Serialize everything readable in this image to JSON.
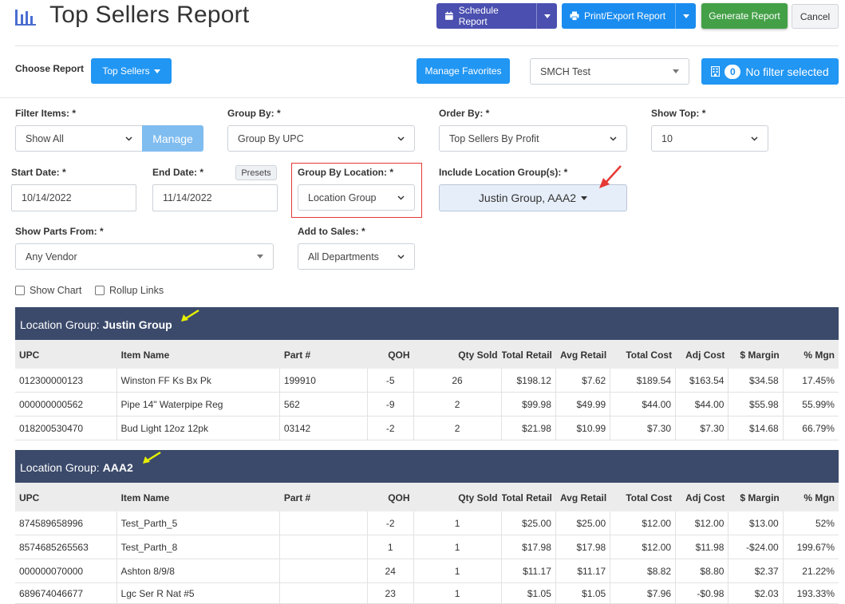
{
  "header": {
    "title": "Top Sellers Report",
    "schedule_label": "Schedule Report",
    "print_label": "Print/Export Report",
    "generate_label": "Generate Report",
    "cancel_label": "Cancel"
  },
  "toolbar": {
    "choose_report_label": "Choose Report",
    "report_type": "Top Sellers",
    "manage_favorites_label": "Manage Favorites",
    "store_value": "SMCH Test",
    "filter_count": "0",
    "filter_label": "No filter selected"
  },
  "filters": {
    "filter_items_label": "Filter Items: *",
    "filter_items_value": "Show All",
    "manage_label": "Manage",
    "group_by_label": "Group By: *",
    "group_by_value": "Group By UPC",
    "order_by_label": "Order By: *",
    "order_by_value": "Top Sellers By Profit",
    "show_top_label": "Show Top: *",
    "show_top_value": "10",
    "start_date_label": "Start Date: *",
    "start_date_value": "10/14/2022",
    "end_date_label": "End Date: *",
    "end_date_value": "11/14/2022",
    "presets_label": "Presets",
    "group_by_location_label": "Group By Location: *",
    "group_by_location_value": "Location Group",
    "include_groups_label": "Include Location Group(s): *",
    "include_groups_value": "Justin Group, AAA2",
    "show_parts_label": "Show Parts From: *",
    "show_parts_value": "Any Vendor",
    "add_to_sales_label": "Add to Sales: *",
    "add_to_sales_value": "All Departments",
    "show_chart_label": "Show Chart",
    "rollup_links_label": "Rollup Links"
  },
  "table": {
    "columns": [
      "UPC",
      "Item Name",
      "Part #",
      "QOH",
      "Qty Sold",
      "Total Retail",
      "Avg Retail",
      "Total Cost",
      "Adj Cost",
      "$ Margin",
      "% Mgn"
    ],
    "groups": [
      {
        "prefix": "Location Group:",
        "name": "Justin Group",
        "rows": [
          [
            "012300000123",
            "Winston FF Ks Bx Pk",
            "199910",
            "-5",
            "26",
            "$198.12",
            "$7.62",
            "$189.54",
            "$163.54",
            "$34.58",
            "17.45%"
          ],
          [
            "000000000562",
            "Pipe 14\" Waterpipe Reg",
            "562",
            "-9",
            "2",
            "$99.98",
            "$49.99",
            "$44.00",
            "$44.00",
            "$55.98",
            "55.99%"
          ],
          [
            "018200530470",
            "Bud Light 12oz 12pk",
            "03142",
            "-2",
            "2",
            "$21.98",
            "$10.99",
            "$7.30",
            "$7.30",
            "$14.68",
            "66.79%"
          ]
        ]
      },
      {
        "prefix": "Location Group:",
        "name": "AAA2",
        "rows": [
          [
            "874589658996",
            "Test_Parth_5",
            "",
            "-2",
            "1",
            "$25.00",
            "$25.00",
            "$12.00",
            "$12.00",
            "$13.00",
            "52%"
          ],
          [
            "8574685265563",
            "Test_Parth_8",
            "",
            "1",
            "1",
            "$17.98",
            "$17.98",
            "$12.00",
            "$11.98",
            "-$24.00",
            "199.67%"
          ],
          [
            "000000070000",
            "Ashton 8/9/8",
            "",
            "24",
            "1",
            "$11.17",
            "$11.17",
            "$8.82",
            "$8.80",
            "$2.37",
            "21.22%"
          ],
          [
            "689674046677",
            "Lgc Ser R Nat #5",
            "",
            "23",
            "1",
            "$1.05",
            "$1.05",
            "$7.96",
            "-$0.98",
            "$2.03",
            "193.33%"
          ]
        ]
      }
    ]
  },
  "colors": {
    "purple_button": "#4a4fb0",
    "blue_button": "#2196f3",
    "green_button": "#43a047",
    "group_header": "#3b4a6b",
    "highlight_box": "#e53935",
    "red_arrow": "#e53935",
    "yellow_arrow": "#e6f000"
  }
}
